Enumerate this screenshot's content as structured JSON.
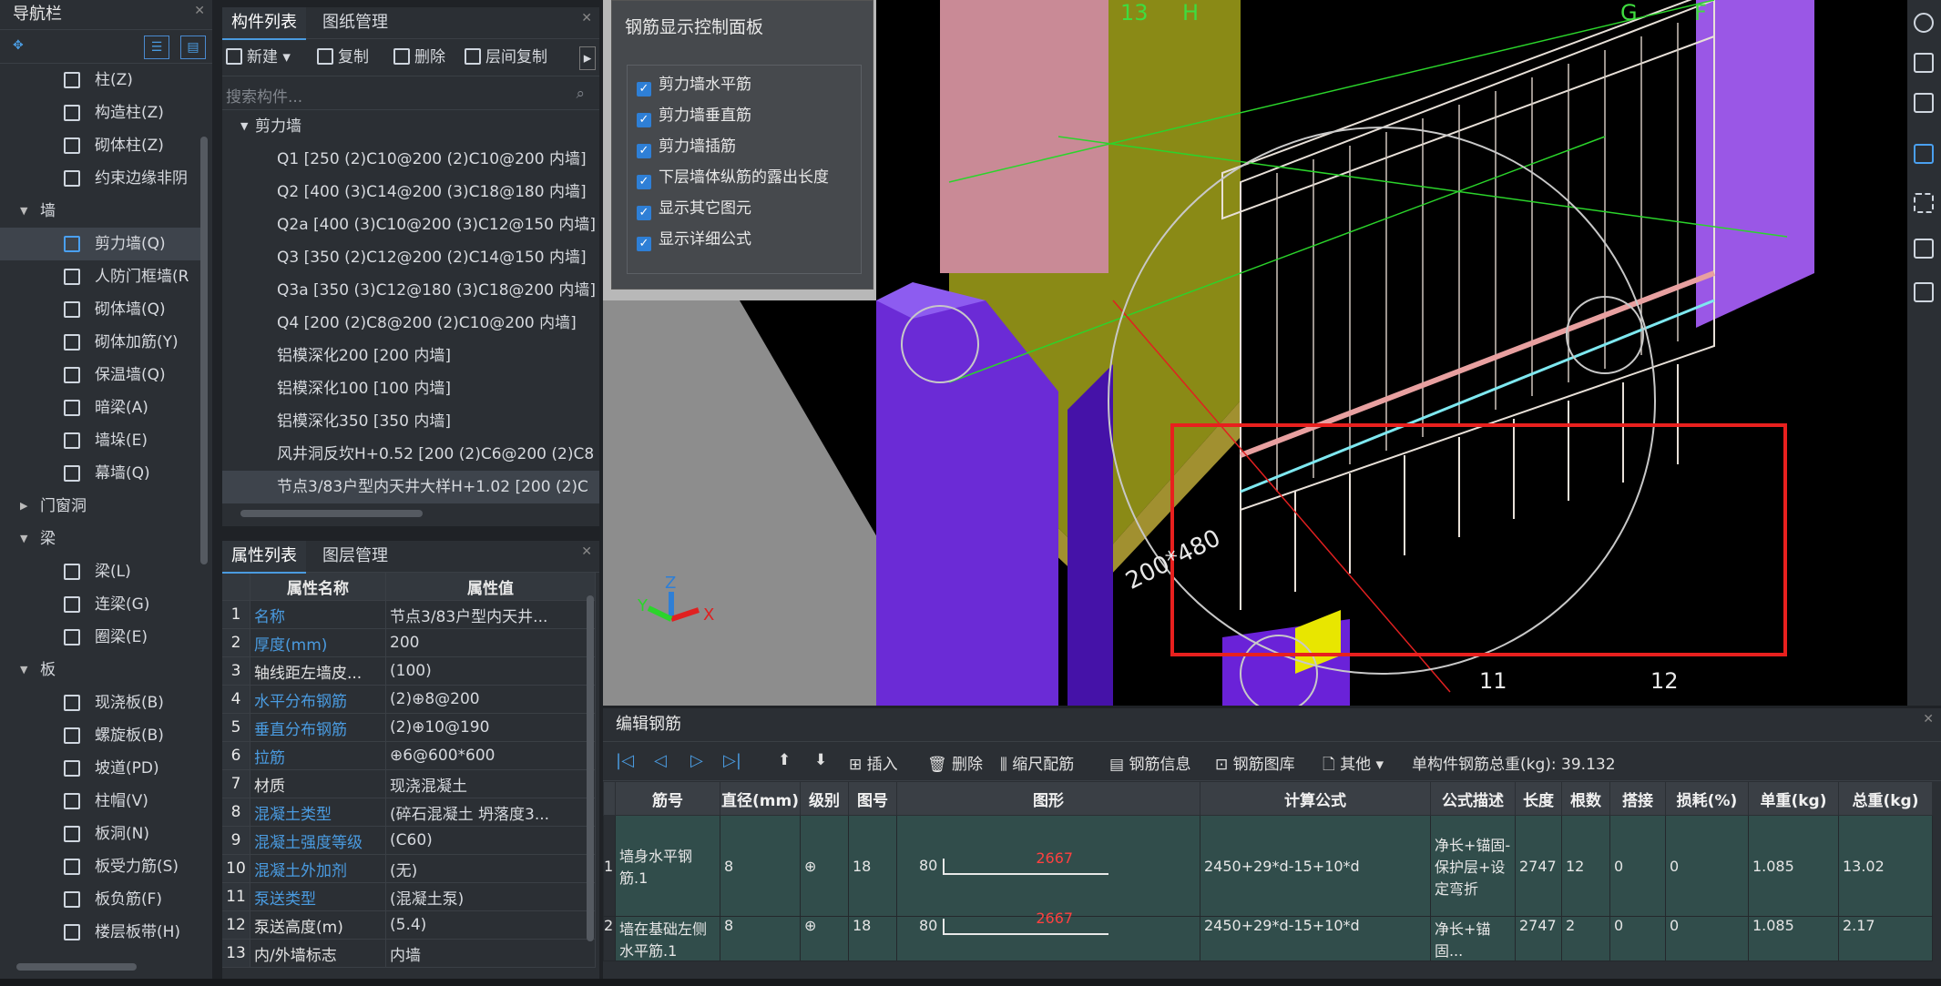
{
  "nav": {
    "title": "导航栏",
    "items": [
      {
        "type": "item",
        "label": "柱(Z)"
      },
      {
        "type": "item",
        "label": "构造柱(Z)"
      },
      {
        "type": "item",
        "label": "砌体柱(Z)"
      },
      {
        "type": "item",
        "label": "约束边缘非阴"
      },
      {
        "type": "cat",
        "label": "墙",
        "open": true
      },
      {
        "type": "item",
        "label": "剪力墙(Q)",
        "selected": true
      },
      {
        "type": "item",
        "label": "人防门框墙(R"
      },
      {
        "type": "item",
        "label": "砌体墙(Q)"
      },
      {
        "type": "item",
        "label": "砌体加筋(Y)"
      },
      {
        "type": "item",
        "label": "保温墙(Q)"
      },
      {
        "type": "item",
        "label": "暗梁(A)"
      },
      {
        "type": "item",
        "label": "墙垛(E)"
      },
      {
        "type": "item",
        "label": "幕墙(Q)"
      },
      {
        "type": "cat",
        "label": "门窗洞",
        "open": false
      },
      {
        "type": "cat",
        "label": "梁",
        "open": true
      },
      {
        "type": "item",
        "label": "梁(L)"
      },
      {
        "type": "item",
        "label": "连梁(G)"
      },
      {
        "type": "item",
        "label": "圈梁(E)"
      },
      {
        "type": "cat",
        "label": "板",
        "open": true
      },
      {
        "type": "item",
        "label": "现浇板(B)"
      },
      {
        "type": "item",
        "label": "螺旋板(B)"
      },
      {
        "type": "item",
        "label": "坡道(PD)"
      },
      {
        "type": "item",
        "label": "柱帽(V)"
      },
      {
        "type": "item",
        "label": "板洞(N)"
      },
      {
        "type": "item",
        "label": "板受力筋(S)"
      },
      {
        "type": "item",
        "label": "板负筋(F)"
      },
      {
        "type": "item",
        "label": "楼层板带(H)"
      }
    ]
  },
  "comp": {
    "tabs": [
      "构件列表",
      "图纸管理"
    ],
    "toolbar": {
      "new": "新建",
      "copy": "复制",
      "delete": "删除",
      "floor_copy": "层间复制"
    },
    "search_placeholder": "搜索构件...",
    "group": "剪力墙",
    "rows": [
      "Q1 [250 (2)C10@200 (2)C10@200 内墙]",
      "Q2 [400 (3)C14@200 (3)C18@180 内墙]",
      "Q2a [400 (3)C10@200 (3)C12@150 内墙]",
      "Q3 [350 (2)C12@200 (2)C14@150 内墙]",
      "Q3a [350 (3)C12@180 (3)C18@200 内墙]",
      "Q4 [200 (2)C8@200 (2)C10@200 内墙]",
      "铝模深化200 [200 内墙]",
      "铝模深化100 [100 内墙]",
      "铝模深化350 [350 内墙]",
      "风井洞反坎H+0.52 [200 (2)C6@200 (2)C8",
      "节点3/83户型内天井大样H+1.02 [200 (2)C"
    ],
    "selected_index": 10
  },
  "props": {
    "tabs": [
      "属性列表",
      "图层管理"
    ],
    "headers": [
      "属性名称",
      "属性值"
    ],
    "rows": [
      {
        "n": "1",
        "k": "名称",
        "v": "节点3/83户型内天井...",
        "blue": true
      },
      {
        "n": "2",
        "k": "厚度(mm)",
        "v": "200",
        "blue": true
      },
      {
        "n": "3",
        "k": "轴线距左墙皮...",
        "v": "(100)",
        "blue": false
      },
      {
        "n": "4",
        "k": "水平分布钢筋",
        "v": "(2)⊕8@200",
        "blue": true
      },
      {
        "n": "5",
        "k": "垂直分布钢筋",
        "v": "(2)⊕10@190",
        "blue": true
      },
      {
        "n": "6",
        "k": "拉筋",
        "v": "⊕6@600*600",
        "blue": true
      },
      {
        "n": "7",
        "k": "材质",
        "v": "现浇混凝土",
        "blue": false
      },
      {
        "n": "8",
        "k": "混凝土类型",
        "v": "(碎石混凝土 坍落度3...",
        "blue": true
      },
      {
        "n": "9",
        "k": "混凝土强度等级",
        "v": "(C60)",
        "blue": true
      },
      {
        "n": "10",
        "k": "混凝土外加剂",
        "v": "(无)",
        "blue": true
      },
      {
        "n": "11",
        "k": "泵送类型",
        "v": "(混凝土泵)",
        "blue": true
      },
      {
        "n": "12",
        "k": "泵送高度(m)",
        "v": "(5.4)",
        "blue": false
      },
      {
        "n": "13",
        "k": "内/外墙标志",
        "v": "内墙",
        "blue": false
      }
    ]
  },
  "rebar_panel": {
    "title": "钢筋显示控制面板",
    "options": [
      "剪力墙水平筋",
      "剪力墙垂直筋",
      "剪力墙插筋",
      "下层墙体纵筋的露出长度",
      "显示其它图元",
      "显示详细公式"
    ]
  },
  "viewport": {
    "axis_labels": [
      "13",
      "H",
      "G",
      "F",
      "11",
      "12"
    ],
    "dimension_label": "200*480",
    "triad": [
      "X",
      "Y",
      "Z"
    ]
  },
  "edit": {
    "title": "编辑钢筋",
    "toolbar": {
      "insert": "插入",
      "delete": "删除",
      "scale": "缩尺配筋",
      "info": "钢筋信息",
      "library": "钢筋图库",
      "other": "其他",
      "total": "单构件钢筋总重(kg): 39.132"
    },
    "headers": [
      "筋号",
      "直径(mm)",
      "级别",
      "图号",
      "图形",
      "计算公式",
      "公式描述",
      "长度",
      "根数",
      "搭接",
      "损耗(%)",
      "单重(kg)",
      "总重(kg)"
    ],
    "rows": [
      {
        "idx": "1",
        "name": "墙身水平钢筋.1",
        "dia": "8",
        "grade": "⊕",
        "fig": "18",
        "shape_left": "80",
        "shape_len": "2667",
        "formula": "2450+29*d-15+10*d",
        "desc": "净长+锚固-保护层+设定弯折",
        "len": "2747",
        "count": "12",
        "lap": "0",
        "loss": "0",
        "unit": "1.085",
        "total": "13.02"
      },
      {
        "idx": "2",
        "name": "墙在基础左侧水平筋.1",
        "dia": "8",
        "grade": "⊕",
        "fig": "18",
        "shape_left": "80",
        "shape_len": "2667",
        "formula": "2450+29*d-15+10*d",
        "desc": "净长+锚固...",
        "len": "2747",
        "count": "2",
        "lap": "0",
        "loss": "0",
        "unit": "1.085",
        "total": "2.17"
      }
    ]
  }
}
